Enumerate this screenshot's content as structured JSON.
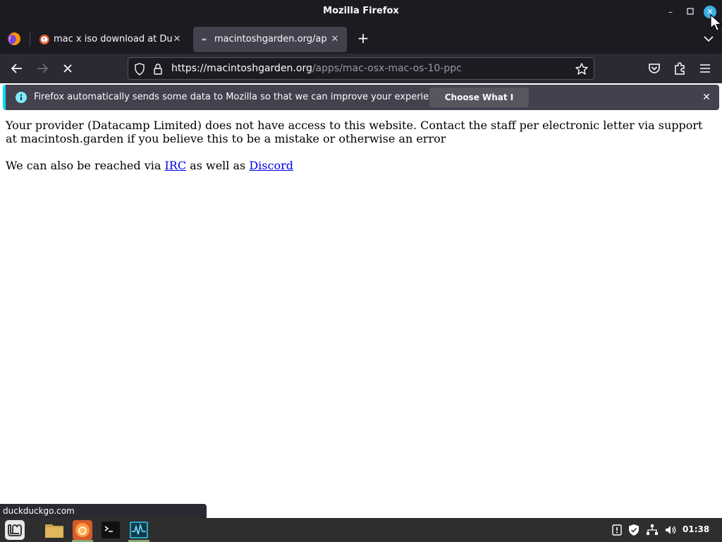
{
  "window": {
    "title": "Mozilla Firefox"
  },
  "tabs": [
    {
      "title": "mac x iso download at Duck",
      "active": false
    },
    {
      "title": "macintoshgarden.org/apps/m",
      "active": true
    }
  ],
  "navbar": {
    "url_host": "https://macintoshgarden.org",
    "url_path": "/apps/mac-osx-mac-os-10-ppc"
  },
  "notification": {
    "message": "Firefox automatically sends some data to Mozilla so that we can improve your experience.",
    "button": "Choose What I Share"
  },
  "page": {
    "p1": "Your provider (Datacamp Limited) does not have access to this website. Contact the staff per electronic letter via support at macintosh.garden if you believe this to be a mistake or otherwise an error",
    "p2_before": "We can also be reached via ",
    "p2_link1": "IRC",
    "p2_middle": " as well as ",
    "p2_link2": "Discord"
  },
  "status_text": "duckduckgo.com",
  "taskbar": {
    "clock": "01:38"
  },
  "colors": {
    "accent": "#00ddff",
    "chrome_dark": "#1c1b22",
    "toolbar": "#2b2a33",
    "link": "#0000ee"
  }
}
